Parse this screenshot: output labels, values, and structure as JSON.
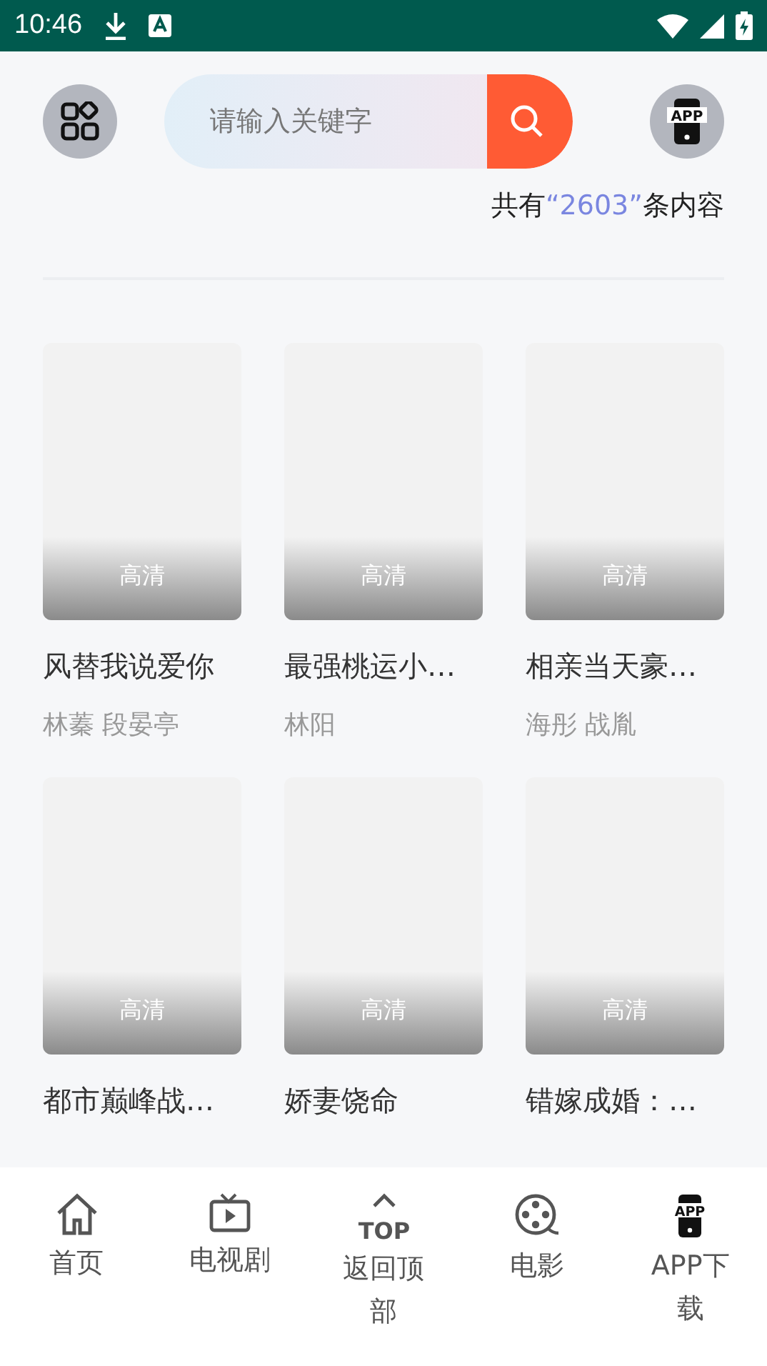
{
  "status_bar": {
    "time": "10:46"
  },
  "app_button": {
    "icon_text": "APP"
  },
  "search": {
    "placeholder": "请输入关键字"
  },
  "result_count": {
    "prefix": "共有",
    "number": "“2603”",
    "suffix": "条内容"
  },
  "videos": [
    {
      "badge": "高清",
      "title": "风替我说爱你",
      "cast": "林蓁 段晏亭"
    },
    {
      "badge": "高清",
      "title": "最强桃运小…",
      "cast": "林阳"
    },
    {
      "badge": "高清",
      "title": "相亲当天豪…",
      "cast": "海彤 战胤"
    },
    {
      "badge": "高清",
      "title": "都市巅峰战…"
    },
    {
      "badge": "高清",
      "title": "娇妻饶命"
    },
    {
      "badge": "高清",
      "title": "错嫁成婚：…"
    }
  ],
  "bottom_nav": [
    {
      "kind": "home",
      "label": "首页"
    },
    {
      "kind": "tv",
      "label": "电视剧"
    },
    {
      "kind": "top",
      "label": "返回顶部",
      "icon_text": "TOP"
    },
    {
      "kind": "film",
      "label": "电影"
    },
    {
      "kind": "app",
      "label": "APP下载",
      "icon_text": "APP"
    }
  ]
}
